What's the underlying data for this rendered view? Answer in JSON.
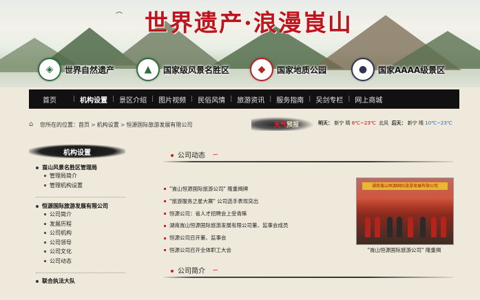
{
  "banner": {
    "title": "世界遗产·浪漫崀山",
    "logos": [
      {
        "icon": "world-heritage-emblem-icon",
        "label": "世界自然遗产"
      },
      {
        "icon": "scenic-area-emblem-icon",
        "label": "国家级风景名胜区"
      },
      {
        "icon": "geopark-emblem-icon",
        "label": "国家地质公园"
      },
      {
        "icon": "aaaa-emblem-icon",
        "label": "国家AAAA级景区"
      }
    ]
  },
  "nav": {
    "items": [
      "首页",
      "机构设置",
      "景区介绍",
      "图片视频",
      "民俗风情",
      "旅游资讯",
      "服务指南",
      "㕦剑专栏",
      "网上商城"
    ],
    "active_index": 1
  },
  "breadcrumb": {
    "prefix": "您所在的位置：",
    "items": [
      "首页",
      "机构设置",
      "恒源国际旅游发展有限公司"
    ]
  },
  "weather": {
    "label_a": "天气",
    "label_b": "预报",
    "today_label": "明天：",
    "today_city": "新宁",
    "today_cond": "晴",
    "today_temp": "8℃~23℃",
    "extra": "北风",
    "tomorrow_label": "后天：",
    "tomorrow_city": "新宁",
    "tomorrow_cond": "晴",
    "tomorrow_temp": "10℃~23℃"
  },
  "sidebar": {
    "title": "机构设置",
    "groups": [
      {
        "title": "崀山风景名胜区管理局",
        "items": [
          "管理局简介",
          "管理机构设置"
        ]
      },
      {
        "title": "恒源国际旅游发展有限公司",
        "items": [
          "公司简介",
          "发展历程",
          "公司机构",
          "公司领导",
          "公司文化",
          "公司动态"
        ]
      },
      {
        "title": "联合执法大队",
        "items": []
      }
    ]
  },
  "main": {
    "section1_title": "公司动态",
    "news": [
      "\"崀山恒源国际旅游公司\" 隆重揭牌",
      "\"旅游服务之星大赛\" 公司选手表现突出",
      "恒源公司：省人才招聘会上受青睐",
      "湖南崀山恒源国际旅游发展有限公司董、监事会成员",
      "恒源公司召开董、监事会",
      "恒源公司召开全体职工大会"
    ],
    "photo_banner": "湖南崀山恒源国际旅游发展有限公司",
    "photo_caption": "\"崀山恒源国际旅游公司\" 隆重揭",
    "section2_title": "公司简介"
  }
}
